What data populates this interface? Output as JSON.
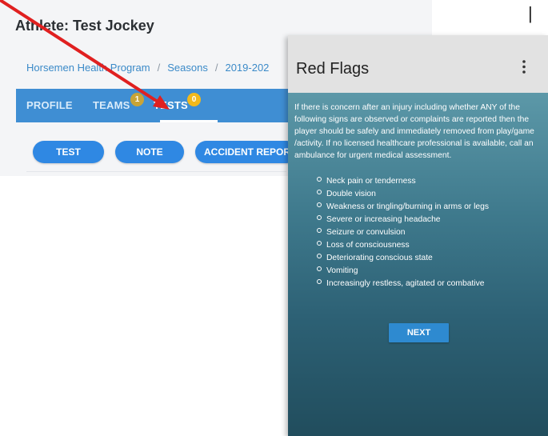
{
  "athlete": {
    "title": "Athlete: Test Jockey"
  },
  "breadcrumb": {
    "items": [
      "Horsemen Health Program",
      "Seasons",
      "2019-202"
    ],
    "separator": "/"
  },
  "tabs": [
    {
      "label": "PROFILE"
    },
    {
      "label": "TEAMS",
      "badge": "1"
    },
    {
      "label": "TESTS",
      "badge": "0"
    }
  ],
  "actions": {
    "test": "TEST",
    "note": "NOTE",
    "accident": "ACCIDENT REPORT"
  },
  "modal": {
    "title": "Red Flags",
    "menu_icon": "more-vertical-icon",
    "intro": "If there is concern after an injury including whether ANY of the following signs are observed or complaints are reported then the player should be safely and immediately removed from play/game /activity. If no licensed healthcare professional is available, call an ambulance for urgent medical assessment.",
    "flags": [
      "Neck pain or tenderness",
      "Double vision",
      "Weakness or tingling/burning in arms or legs",
      "Severe or increasing headache",
      "Seizure or convulsion",
      "Loss of consciousness",
      "Deteriorating conscious state",
      "Vomiting",
      "Increasingly restless, agitated or combative"
    ],
    "next_label": "NEXT"
  },
  "colors": {
    "tab_bar": "#3f8ed3",
    "badge_teams": "#c9a437",
    "badge_tests": "#f2b91c",
    "button": "#2f88e3",
    "arrow": "#e02020"
  }
}
